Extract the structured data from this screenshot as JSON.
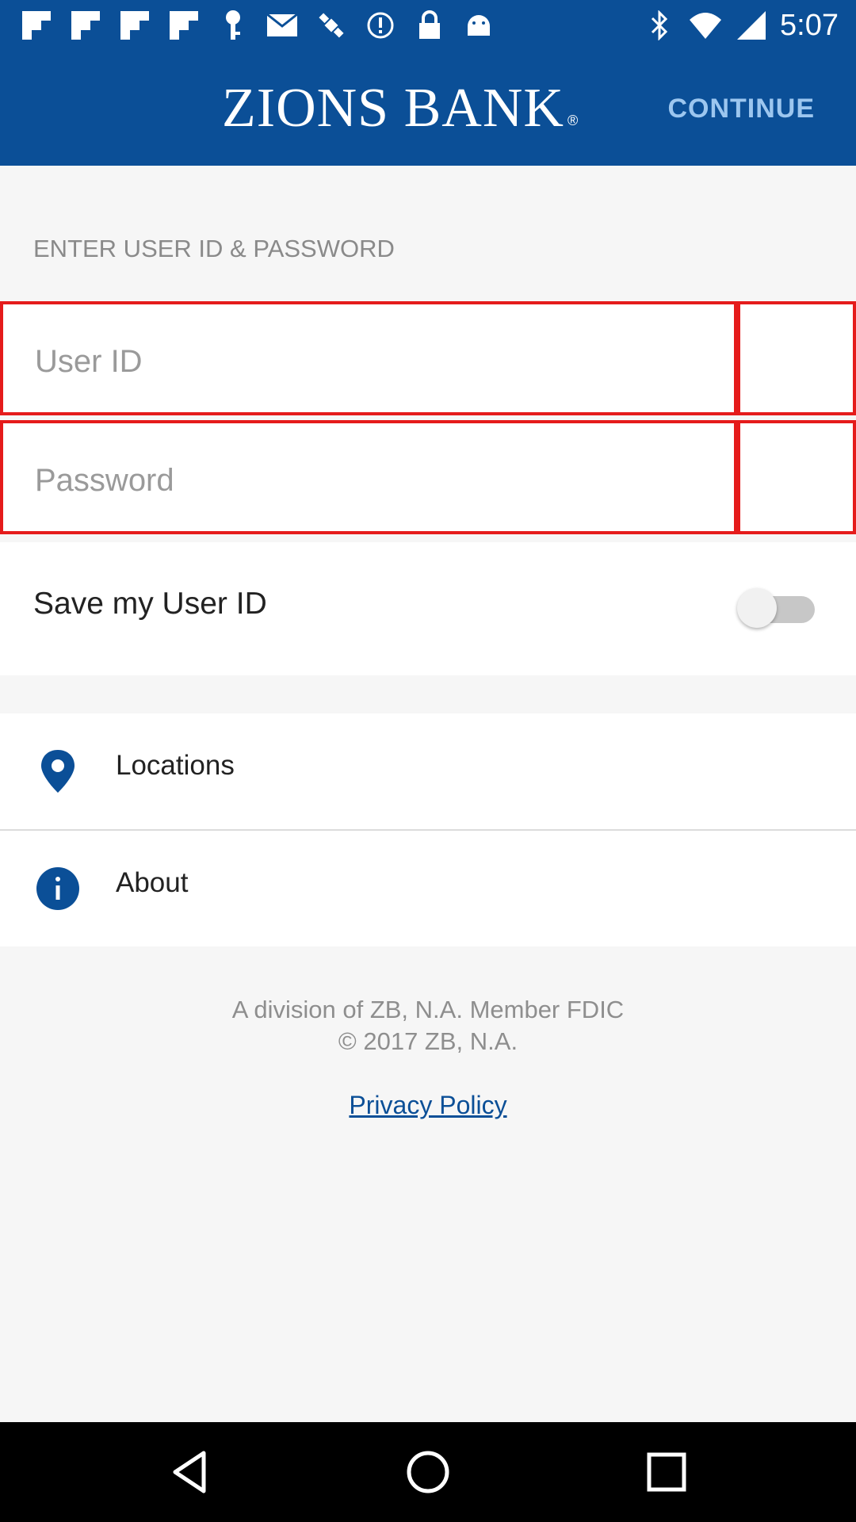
{
  "status_bar": {
    "time": "5:07",
    "icons": [
      "flipboard-icon",
      "flipboard-icon",
      "flipboard-icon",
      "flipboard-icon",
      "vpn-key-icon",
      "mail-icon",
      "satellite-icon",
      "alert-icon",
      "lock-icon",
      "android-icon",
      "bluetooth-icon",
      "wifi-icon",
      "signal-icon"
    ]
  },
  "header": {
    "brand": "ZIONS BANK",
    "brand_mark": "®",
    "continue_label": "CONTINUE"
  },
  "login": {
    "section_label": "ENTER USER ID & PASSWORD",
    "user_id_placeholder": "User ID",
    "user_id_value": "",
    "password_placeholder": "Password",
    "password_value": ""
  },
  "save_user_id": {
    "label": "Save my User ID",
    "enabled": false
  },
  "menu": {
    "items": [
      {
        "label": "Locations",
        "icon": "location-pin-icon"
      },
      {
        "label": "About",
        "icon": "info-icon"
      }
    ]
  },
  "footer": {
    "line1": "A division of ZB, N.A. Member FDIC",
    "line2": "© 2017 ZB, N.A.",
    "privacy_label": "Privacy Policy"
  },
  "colors": {
    "brand_blue": "#0b4f97",
    "continue_text": "#9cc6ef",
    "error_border": "#e51b1b",
    "background": "#f6f6f6"
  }
}
